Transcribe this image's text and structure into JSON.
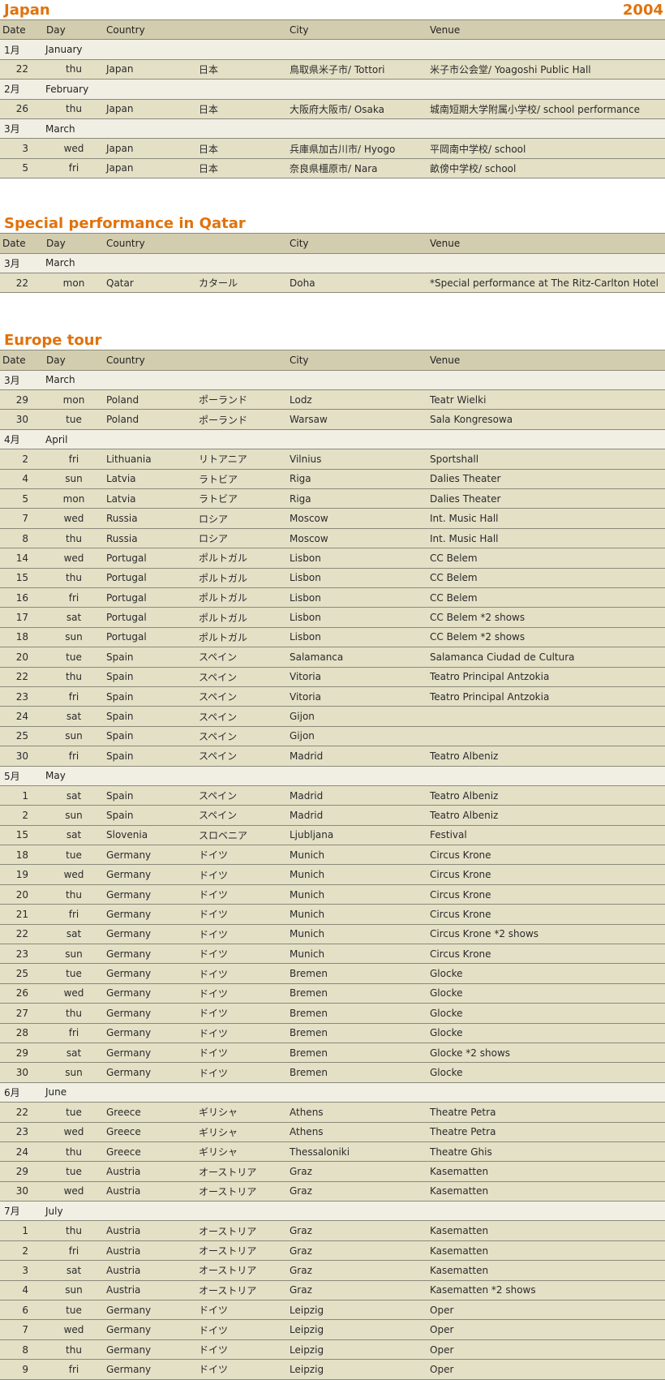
{
  "headers": [
    "Date",
    "Day",
    "Country",
    "",
    "City",
    "Venue"
  ],
  "sections": [
    {
      "title": "Japan",
      "year": "2004",
      "months": [
        {
          "num": "1月",
          "name": "January",
          "rows": [
            [
              "22",
              "thu",
              "Japan",
              "日本",
              "鳥取県米子市/ Tottori",
              "米子市公会堂/ Yoagoshi Public Hall"
            ]
          ]
        },
        {
          "num": "2月",
          "name": "February",
          "rows": [
            [
              "26",
              "thu",
              "Japan",
              "日本",
              "大阪府大阪市/ Osaka",
              "城南短期大学附属小学校/ school performance"
            ]
          ]
        },
        {
          "num": "3月",
          "name": "March",
          "rows": [
            [
              "3",
              "wed",
              "Japan",
              "日本",
              "兵庫県加古川市/ Hyogo",
              "平岡南中学校/ school"
            ],
            [
              "5",
              "fri",
              "Japan",
              "日本",
              "奈良県橿原市/ Nara",
              "畝傍中学校/ school"
            ]
          ]
        }
      ]
    },
    {
      "title": "Special performance in Qatar",
      "year": "",
      "months": [
        {
          "num": "3月",
          "name": "March",
          "rows": [
            [
              "22",
              "mon",
              "Qatar",
              "カタール",
              "Doha",
              "*Special performance at The Ritz-Carlton Hotel"
            ]
          ]
        }
      ]
    },
    {
      "title": "Europe tour",
      "year": "",
      "months": [
        {
          "num": "3月",
          "name": "March",
          "rows": [
            [
              "29",
              "mon",
              "Poland",
              "ポーランド",
              "Lodz",
              "Teatr Wielki"
            ],
            [
              "30",
              "tue",
              "Poland",
              "ポーランド",
              "Warsaw",
              "Sala Kongresowa"
            ]
          ]
        },
        {
          "num": "4月",
          "name": "April",
          "rows": [
            [
              "2",
              "fri",
              "Lithuania",
              "リトアニア",
              "Vilnius",
              "Sportshall"
            ],
            [
              "4",
              "sun",
              "Latvia",
              "ラトビア",
              "Riga",
              "Dalies Theater"
            ],
            [
              "5",
              "mon",
              "Latvia",
              "ラトビア",
              "Riga",
              "Dalies Theater"
            ],
            [
              "7",
              "wed",
              "Russia",
              "ロシア",
              "Moscow",
              "Int. Music Hall"
            ],
            [
              "8",
              "thu",
              "Russia",
              "ロシア",
              "Moscow",
              "Int. Music Hall"
            ],
            [
              "14",
              "wed",
              "Portugal",
              "ポルトガル",
              "Lisbon",
              "CC Belem"
            ],
            [
              "15",
              "thu",
              "Portugal",
              "ポルトガル",
              "Lisbon",
              "CC Belem"
            ],
            [
              "16",
              "fri",
              "Portugal",
              "ポルトガル",
              "Lisbon",
              "CC Belem"
            ],
            [
              "17",
              "sat",
              "Portugal",
              "ポルトガル",
              "Lisbon",
              "CC Belem  *2 shows"
            ],
            [
              "18",
              "sun",
              "Portugal",
              "ポルトガル",
              "Lisbon",
              "CC Belem  *2 shows"
            ],
            [
              "20",
              "tue",
              "Spain",
              "スペイン",
              "Salamanca",
              "Salamanca Ciudad de Cultura"
            ],
            [
              "22",
              "thu",
              "Spain",
              "スペイン",
              "Vitoria",
              "Teatro Principal Antzokia"
            ],
            [
              "23",
              "fri",
              "Spain",
              "スペイン",
              "Vitoria",
              "Teatro Principal Antzokia"
            ],
            [
              "24",
              "sat",
              "Spain",
              "スペイン",
              "Gijon",
              ""
            ],
            [
              "25",
              "sun",
              "Spain",
              "スペイン",
              "Gijon",
              ""
            ],
            [
              "30",
              "fri",
              "Spain",
              "スペイン",
              "Madrid",
              "Teatro Albeniz"
            ]
          ]
        },
        {
          "num": "5月",
          "name": "May",
          "rows": [
            [
              "1",
              "sat",
              "Spain",
              "スペイン",
              "Madrid",
              "Teatro Albeniz"
            ],
            [
              "2",
              "sun",
              "Spain",
              "スペイン",
              "Madrid",
              "Teatro Albeniz"
            ],
            [
              "15",
              "sat",
              "Slovenia",
              "スロベニア",
              "Ljubljana",
              "Festival"
            ],
            [
              "18",
              "tue",
              "Germany",
              "ドイツ",
              "Munich",
              "Circus Krone"
            ],
            [
              "19",
              "wed",
              "Germany",
              "ドイツ",
              "Munich",
              "Circus Krone"
            ],
            [
              "20",
              "thu",
              "Germany",
              "ドイツ",
              "Munich",
              "Circus Krone"
            ],
            [
              "21",
              "fri",
              "Germany",
              "ドイツ",
              "Munich",
              "Circus Krone"
            ],
            [
              "22",
              "sat",
              "Germany",
              "ドイツ",
              "Munich",
              "Circus Krone  *2 shows"
            ],
            [
              "23",
              "sun",
              "Germany",
              "ドイツ",
              "Munich",
              "Circus Krone"
            ],
            [
              "25",
              "tue",
              "Germany",
              "ドイツ",
              "Bremen",
              "Glocke"
            ],
            [
              "26",
              "wed",
              "Germany",
              "ドイツ",
              "Bremen",
              "Glocke"
            ],
            [
              "27",
              "thu",
              "Germany",
              "ドイツ",
              "Bremen",
              "Glocke"
            ],
            [
              "28",
              "fri",
              "Germany",
              "ドイツ",
              "Bremen",
              "Glocke"
            ],
            [
              "29",
              "sat",
              "Germany",
              "ドイツ",
              "Bremen",
              "Glocke  *2 shows"
            ],
            [
              "30",
              "sun",
              "Germany",
              "ドイツ",
              "Bremen",
              "Glocke"
            ]
          ]
        },
        {
          "num": "6月",
          "name": "June",
          "rows": [
            [
              "22",
              "tue",
              "Greece",
              "ギリシャ",
              "Athens",
              "Theatre Petra"
            ],
            [
              "23",
              "wed",
              "Greece",
              "ギリシャ",
              "Athens",
              "Theatre Petra"
            ],
            [
              "24",
              "thu",
              "Greece",
              "ギリシャ",
              "Thessaloniki",
              "Theatre Ghis"
            ],
            [
              "29",
              "tue",
              "Austria",
              "オーストリア",
              "Graz",
              "Kasematten"
            ],
            [
              "30",
              "wed",
              "Austria",
              "オーストリア",
              "Graz",
              "Kasematten"
            ]
          ]
        },
        {
          "num": "7月",
          "name": "July",
          "rows": [
            [
              "1",
              "thu",
              "Austria",
              "オーストリア",
              "Graz",
              "Kasematten"
            ],
            [
              "2",
              "fri",
              "Austria",
              "オーストリア",
              "Graz",
              "Kasematten"
            ],
            [
              "3",
              "sat",
              "Austria",
              "オーストリア",
              "Graz",
              "Kasematten"
            ],
            [
              "4",
              "sun",
              "Austria",
              "オーストリア",
              "Graz",
              "Kasematten  *2 shows"
            ],
            [
              "6",
              "tue",
              "Germany",
              "ドイツ",
              "Leipzig",
              "Oper"
            ],
            [
              "7",
              "wed",
              "Germany",
              "ドイツ",
              "Leipzig",
              "Oper"
            ],
            [
              "8",
              "thu",
              "Germany",
              "ドイツ",
              "Leipzig",
              "Oper"
            ],
            [
              "9",
              "fri",
              "Germany",
              "ドイツ",
              "Leipzig",
              "Oper"
            ]
          ]
        }
      ]
    }
  ]
}
